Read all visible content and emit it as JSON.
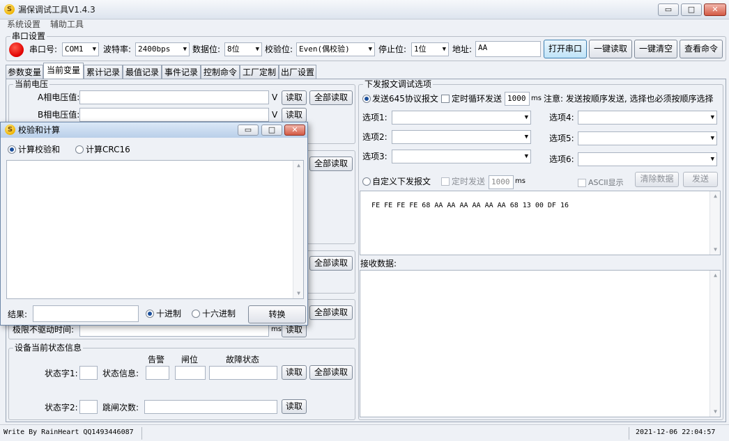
{
  "window": {
    "title": "漏保调试工具V1.4.3",
    "app_icon_glyph": "S"
  },
  "window_controls": {
    "minimize": "▭",
    "maximize": "□",
    "close": "✕"
  },
  "menu": {
    "items": [
      "系统设置",
      "辅助工具"
    ]
  },
  "serial": {
    "group_title": "串口设置",
    "port_label": "串口号:",
    "port_value": "COM1",
    "baud_label": "波特率:",
    "baud_value": "2400bps",
    "databits_label": "数据位:",
    "databits_value": "8位",
    "parity_label": "校验位:",
    "parity_value": "Even(偶校验)",
    "stopbits_label": "停止位:",
    "stopbits_value": "1位",
    "address_label": "地址:",
    "address_value": "AA",
    "buttons": [
      "打开串口",
      "一键读取",
      "一键清空",
      "查看命令"
    ]
  },
  "tabs": [
    "参数变量",
    "当前变量",
    "累计记录",
    "最值记录",
    "事件记录",
    "控制命令",
    "工厂定制",
    "出厂设置"
  ],
  "current_voltage": {
    "group_title": "当前电压",
    "a_label": "A相电压值:",
    "b_label": "B相电压值:",
    "unit": "V",
    "read_label": "读取",
    "read_all_label": "全部读取"
  },
  "left_panels": {
    "read_all_label": "全部读取",
    "limit_label": "极限不驱动时间:",
    "limit_unit": "ms",
    "read_label": "读取"
  },
  "device_status": {
    "group_title": "设备当前状态信息",
    "col_headers": [
      "告警",
      "闸位",
      "故障状态"
    ],
    "status1_label": "状态字1:",
    "status_info_label": "状态信息:",
    "status2_label": "状态字2:",
    "trip_count_label": "跳闸次数:",
    "read_label": "读取",
    "read_all_label": "全部读取"
  },
  "debug": {
    "group_title": "下发报文调试选项",
    "send645_label": "发送645协议报文",
    "loop_label": "定时循环发送",
    "loop_ms": "1000",
    "ms_unit": "ms",
    "note": "注意: 发送按顺序发送, 选择也必须按顺序选择",
    "options": [
      "选项1:",
      "选项2:",
      "选项3:",
      "选项4:",
      "选项5:",
      "选项6:"
    ],
    "custom_label": "自定义下发报文",
    "timed_label": "定时发送",
    "timed_ms": "1000",
    "ascii_label": "ASCII显示",
    "clear_label": "清除数据",
    "send_label": "发送",
    "frame_text": "FE FE FE FE 68 AA AA AA AA AA AA 68 13 00 DF 16",
    "recv_label": "接收数据:"
  },
  "status_bar": {
    "left_text": "Write By RainHeart QQ1493446087",
    "datetime": "2021-12-06 22:04:57"
  },
  "dialog": {
    "title": "校验和计算",
    "radio_sum": "计算校验和",
    "radio_crc": "计算CRC16",
    "result_label": "结果:",
    "radio_dec": "十进制",
    "radio_hex": "十六进制",
    "convert_label": "转换"
  },
  "colors": {
    "accent": "#3c7fb1",
    "led": "#e00000",
    "title_bar": "#dde4ee"
  },
  "icons": {
    "scroll_up": "▲",
    "scroll_down": "▼",
    "dropdown": "▼"
  }
}
